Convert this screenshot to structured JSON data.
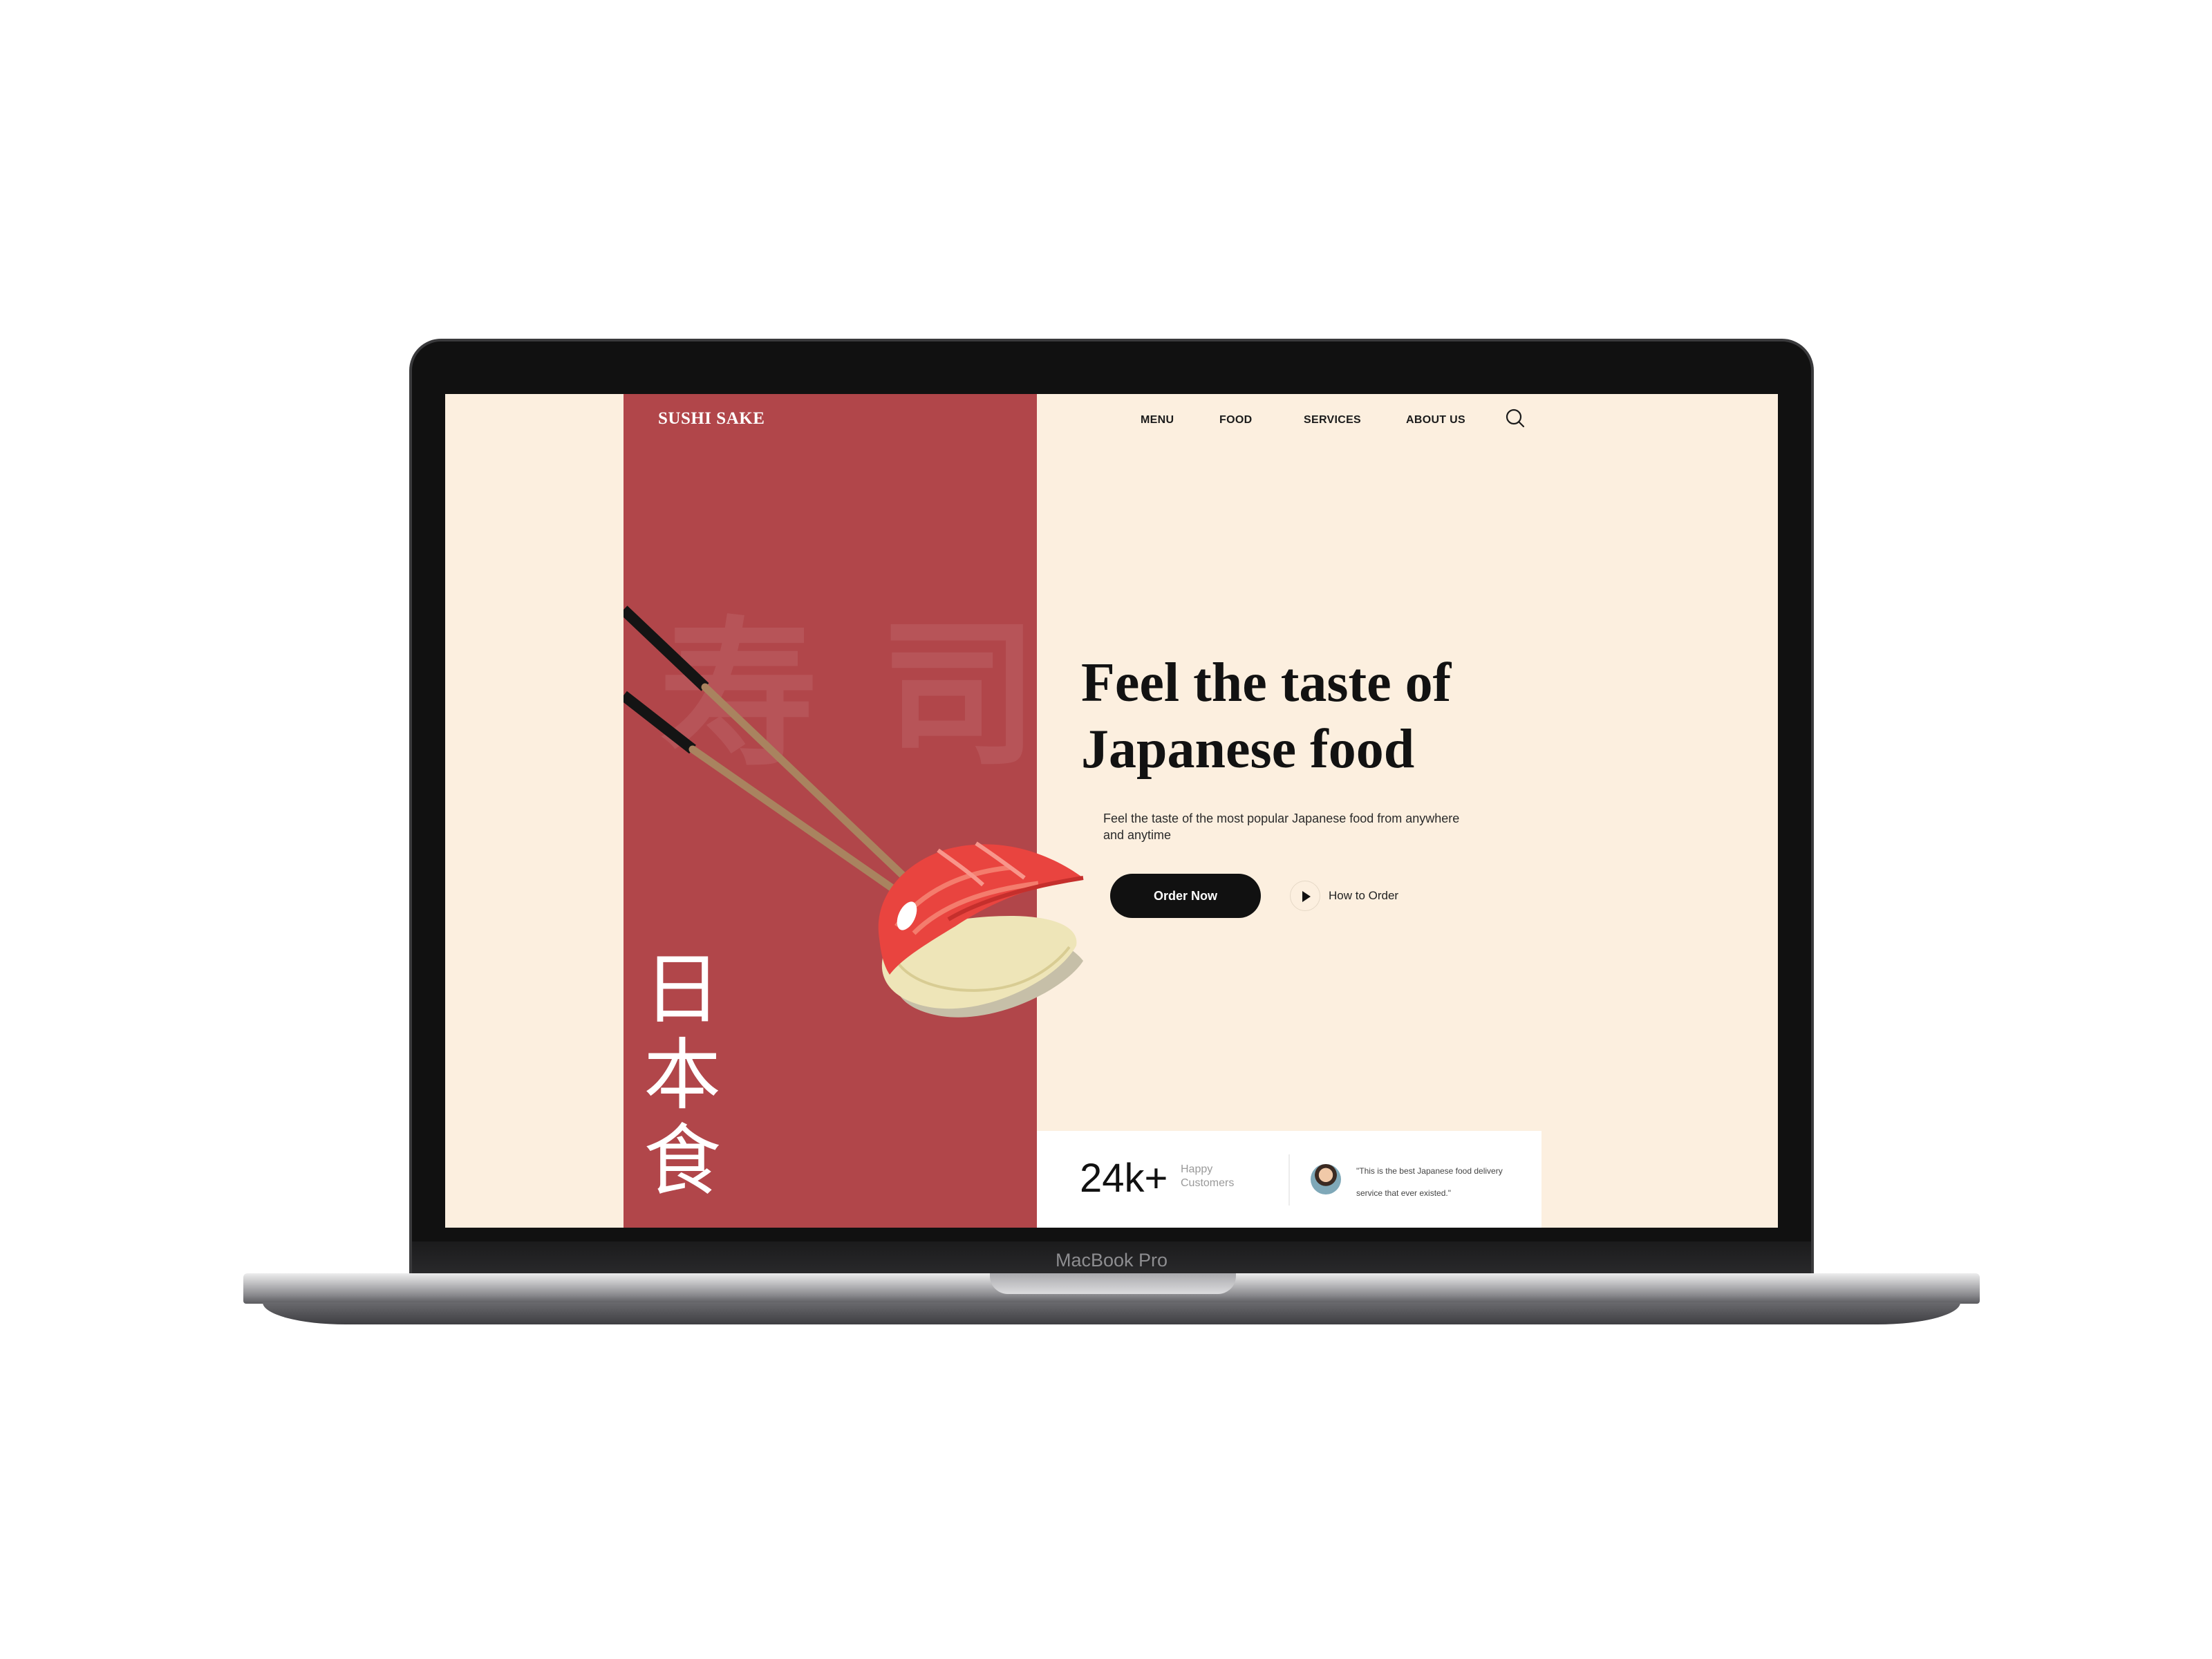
{
  "device": {
    "model_label": "MacBook Pro"
  },
  "site": {
    "brand": "SUSHI SAKE",
    "nav": [
      {
        "label": "MENU"
      },
      {
        "label": "FOOD"
      },
      {
        "label": "SERVICES"
      },
      {
        "label": "ABOUT US"
      }
    ],
    "search_icon": "search-icon"
  },
  "hero": {
    "headline_line1": "Feel the taste of",
    "headline_line2": "Japanese food",
    "subtext": "Feel the taste of the most popular Japanese food from anywhere and anytime",
    "primary_cta": "Order Now",
    "secondary_cta": "How to Order",
    "vertical_kanji": [
      "日",
      "本",
      "食"
    ],
    "watermark_kanji": [
      "寿",
      "司"
    ]
  },
  "stats": {
    "value": "24k+",
    "label": "Happy Customers",
    "testimonial": "\"This is the best Japanese food delivery service that ever existed.\""
  },
  "colors": {
    "background": "#fcefdf",
    "panel_red": "#b1464a",
    "button_dark": "#111111",
    "salmon": "#e9443f",
    "rice": "#eee5b8"
  }
}
